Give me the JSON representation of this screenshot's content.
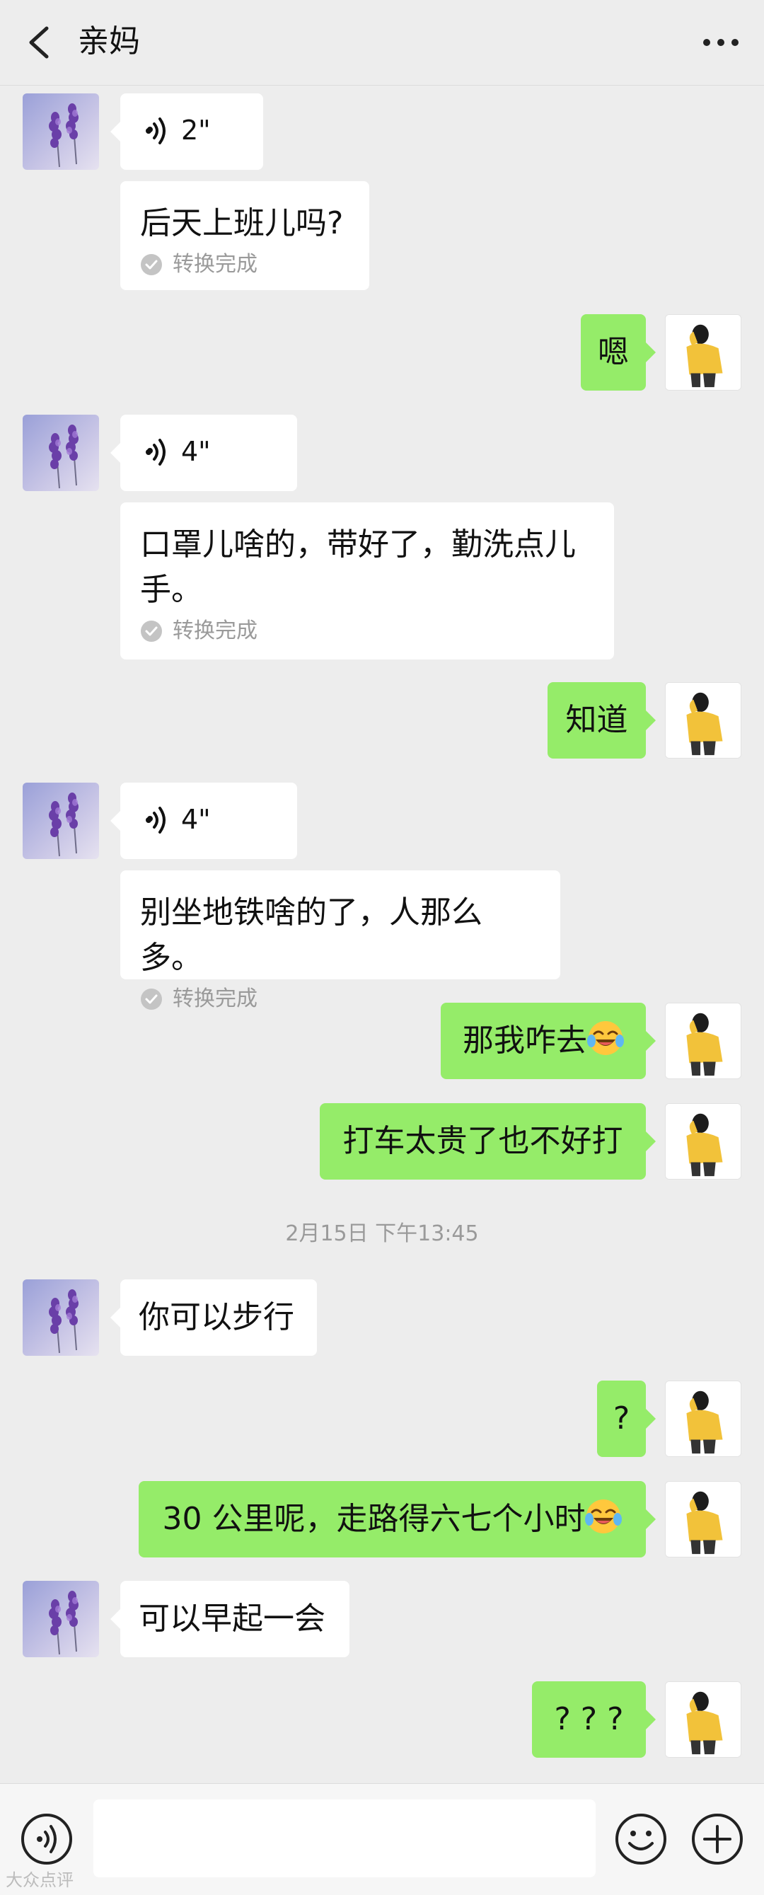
{
  "header": {
    "title": "亲妈"
  },
  "messages": {
    "m1_voice_duration": "2\"",
    "m2_text": "后天上班儿吗?",
    "m2_status": "转换完成",
    "m3_text": "嗯",
    "m4_voice_duration": "4\"",
    "m5_text_line1": "口罩儿啥的，带好了，勤洗点儿",
    "m5_text_line2": "手。",
    "m5_status": "转换完成",
    "m6_text": "知道",
    "m7_voice_duration": "4\"",
    "m8_text": "别坐地铁啥的了，人那么多。",
    "m8_status": "转换完成",
    "m9_text": "那我咋去",
    "m10_text": "打车太贵了也不好打",
    "timestamp": "2月15日 下午13:45",
    "m11_text": "你可以步行",
    "m12_text": "?",
    "m13_text": "30 公里呢，走路得六七个小时",
    "m14_text": "可以早起一会",
    "m15_text": "? ? ?"
  },
  "icons": {
    "back": "chevron-left-icon",
    "more": "more-dots-icon",
    "voice": "voice-wave-icon",
    "check": "check-circle-icon",
    "emoji": "laughing-crying-emoji",
    "input_voice": "voice-input-icon",
    "input_emoji": "smiley-icon",
    "input_plus": "plus-circle-icon"
  },
  "watermark": "大众点评",
  "colors": {
    "background": "#ededed",
    "outgoing_bubble": "#95ec69",
    "incoming_bubble": "#ffffff",
    "muted_text": "#9a9a9a"
  }
}
